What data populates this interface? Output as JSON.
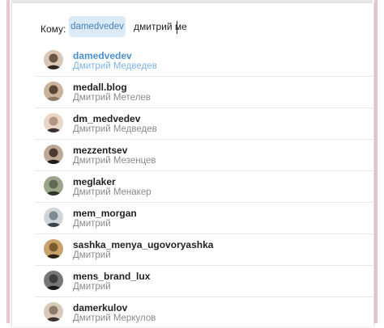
{
  "compose": {
    "to_label": "Кому:",
    "recipient_chip": "damedvedev",
    "query": "дмитрий ме"
  },
  "colors": {
    "chip_bg": "#dbeaf7",
    "chip_text": "#4a80b6",
    "selected_username": "#4a90d0",
    "selected_fullname": "#7eb3e6"
  },
  "suggestions": [
    {
      "username": "damedvedev",
      "fullname": "Дмитрий Медведев",
      "selected": true,
      "avatar_icon": "user-avatar-icon"
    },
    {
      "username": "medall.blog",
      "fullname": "Дмитрий Метелев",
      "selected": false,
      "avatar_icon": "user-avatar-icon"
    },
    {
      "username": "dm_medvedev",
      "fullname": "Дмитрий Медведев",
      "selected": false,
      "avatar_icon": "user-avatar-icon"
    },
    {
      "username": "mezzentsev",
      "fullname": "Дмитрий Мезенцев",
      "selected": false,
      "avatar_icon": "user-avatar-icon"
    },
    {
      "username": "meglaker",
      "fullname": "Дмитрий Менакер",
      "selected": false,
      "avatar_icon": "user-avatar-icon"
    },
    {
      "username": "mem_morgan",
      "fullname": "Дмитрий",
      "selected": false,
      "avatar_icon": "user-avatar-icon"
    },
    {
      "username": "sashka_menya_ugovoryashka",
      "fullname": "Дмитрий",
      "selected": false,
      "avatar_icon": "user-avatar-icon"
    },
    {
      "username": "mens_brand_lux",
      "fullname": "Дмитрий",
      "selected": false,
      "avatar_icon": "user-avatar-icon"
    },
    {
      "username": "damerkulov",
      "fullname": "Дмитрий Меркулов",
      "selected": false,
      "avatar_icon": "user-avatar-icon"
    }
  ]
}
